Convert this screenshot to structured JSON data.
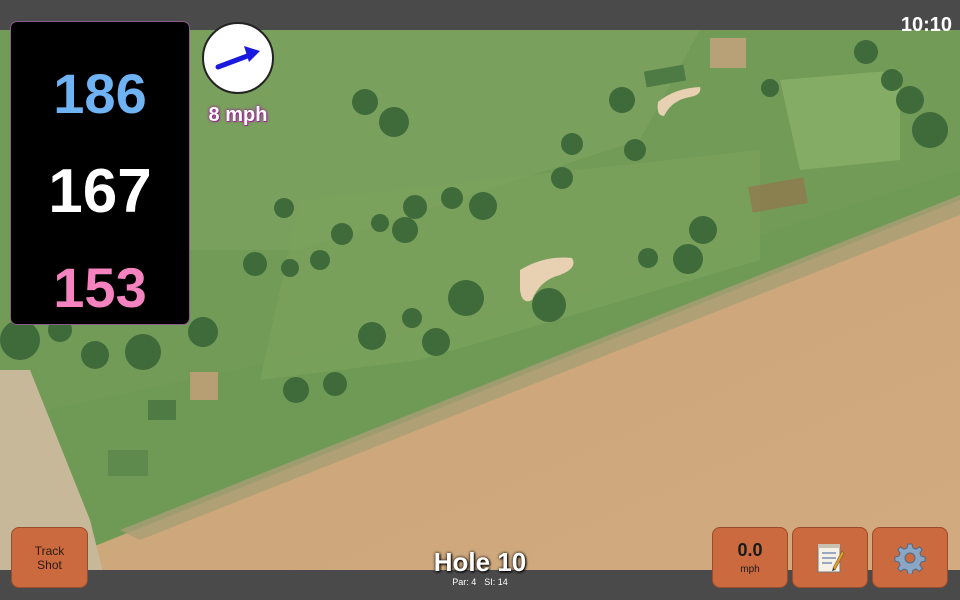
{
  "status": {
    "time": "10:10"
  },
  "distances": {
    "back": "186",
    "middle": "167",
    "front": "153"
  },
  "wind": {
    "speed_label": "8 mph",
    "direction": "east-northeast"
  },
  "buttons": {
    "track_shot": "Track\nShot",
    "speed_value": "0.0",
    "speed_unit": "mph",
    "notes_icon": "notepad-icon",
    "settings_icon": "gear-icon"
  },
  "hole": {
    "title": "Hole 10",
    "par": "Par: 4",
    "si": "SI: 14"
  },
  "colors": {
    "back": "#6fb3f5",
    "middle": "#ffffff",
    "front": "#f483c0",
    "button": "#cb6a3e",
    "wind_arrow": "#1a1adf"
  }
}
